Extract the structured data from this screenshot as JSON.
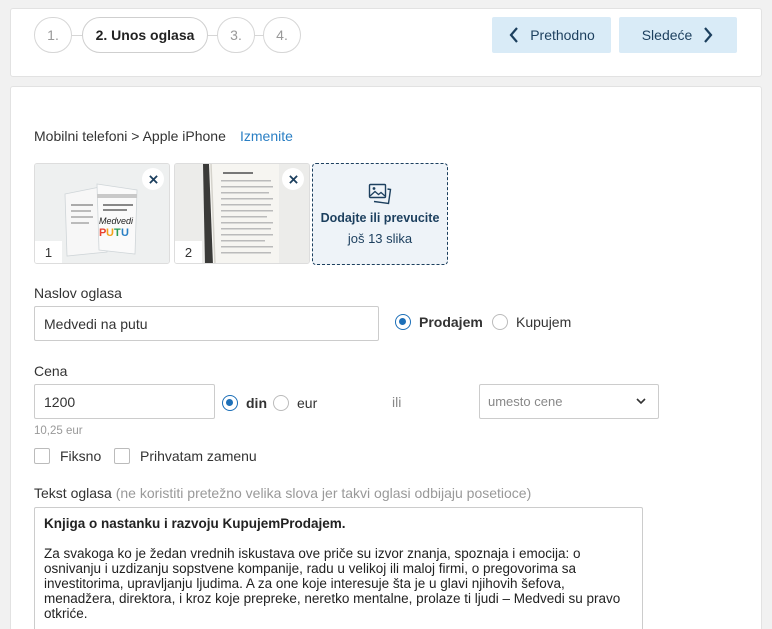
{
  "steps": [
    {
      "label": "1."
    },
    {
      "label": "2. Unos oglasa"
    },
    {
      "label": "3."
    },
    {
      "label": "4."
    }
  ],
  "nav": {
    "prev_label": "Prethodno",
    "next_label": "Sledeće"
  },
  "category": {
    "path": "Mobilni telefoni > Apple iPhone",
    "change_label": "Izmenite"
  },
  "photos": [
    {
      "number": "1"
    },
    {
      "number": "2"
    }
  ],
  "dropzone": {
    "title": "Dodajte ili prevucite",
    "subtitle": "još 13 slika"
  },
  "title_field": {
    "label": "Naslov oglasa",
    "value": "Medvedi na putu"
  },
  "ad_type": {
    "sell_label": "Prodajem",
    "buy_label": "Kupujem",
    "selected": "sell"
  },
  "price": {
    "label": "Cena",
    "value": "1200",
    "currency_din": "din",
    "currency_eur": "eur",
    "selected_currency": "din",
    "converted": "10,25 eur",
    "or_label": "ili",
    "alternative_placeholder": "umesto cene"
  },
  "options": {
    "fixed_label": "Fiksno",
    "exchange_label": "Prihvatam zamenu"
  },
  "description": {
    "label": "Tekst oglasa",
    "hint": "(ne koristiti pretežno velika slova jer takvi oglasi odbijaju posetioce)",
    "heading": "Knjiga o nastanku i razvoju KupujemProdajem.",
    "body": "Za svakoga ko je žedan vrednih iskustava ove priče su izvor znanja, spoznaja i emocija: o osnivanju i uzdizanju sopstvene kompanije, radu u velikoj ili maloj firmi, o pregovorima sa investitorima, upravljanju ljudima. A za one koje interesuje šta je u glavi njihovih šefova, menadžera, direktora, i kroz koje prepreke, neretko mentalne, prolaze ti ljudi – Medvedi su pravo otkriće."
  },
  "colors": {
    "accent": "#1c6fb8",
    "nav_button_bg": "#d9ebf7",
    "link": "#2a7fc4",
    "navy": "#1c3f5e"
  }
}
